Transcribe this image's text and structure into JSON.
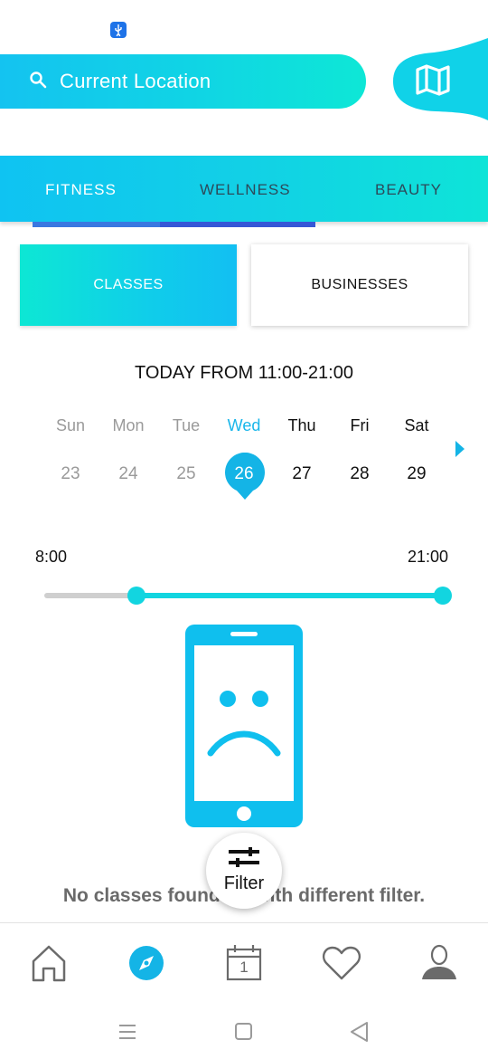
{
  "status_bar": {
    "icons": [
      "usb-icon"
    ]
  },
  "search": {
    "icon": "search-icon",
    "location_label": "Current Location"
  },
  "map_button": {
    "icon": "map-icon"
  },
  "categories": {
    "tabs": [
      {
        "label": "FITNESS",
        "active": true
      },
      {
        "label": "WELLNESS",
        "active": false
      },
      {
        "label": "BEAUTY",
        "active": false
      }
    ]
  },
  "segments": {
    "classes_label": "CLASSES",
    "businesses_label": "BUSINESSES",
    "selected": "CLASSES"
  },
  "schedule": {
    "time_range": "TODAY FROM 11:00-21:00",
    "days": [
      {
        "name": "Sun",
        "date": "23",
        "state": "past"
      },
      {
        "name": "Mon",
        "date": "24",
        "state": "past"
      },
      {
        "name": "Tue",
        "date": "25",
        "state": "past"
      },
      {
        "name": "Wed",
        "date": "26",
        "state": "selected"
      },
      {
        "name": "Thu",
        "date": "27",
        "state": "future"
      },
      {
        "name": "Fri",
        "date": "28",
        "state": "future"
      },
      {
        "name": "Sat",
        "date": "29",
        "state": "future"
      }
    ],
    "next_icon": "chevron-right-icon"
  },
  "time_slider": {
    "min_label": "8:00",
    "max_label": "21:00",
    "range_start": "11:00",
    "range_end": "21:00"
  },
  "empty_state": {
    "icon": "sad-phone-icon",
    "message": "No classes found try with different filter."
  },
  "filter": {
    "label": "Filter",
    "icon": "filter-sliders-icon"
  },
  "bottom_nav": {
    "items": [
      {
        "icon": "home-icon",
        "active": false
      },
      {
        "icon": "compass-icon",
        "active": true
      },
      {
        "icon": "calendar-icon",
        "active": false,
        "badge_text": "1"
      },
      {
        "icon": "heart-icon",
        "active": false
      },
      {
        "icon": "profile-icon",
        "active": false
      }
    ]
  },
  "system_nav": {
    "icons": [
      "recents-icon",
      "home-square-icon",
      "back-triangle-icon"
    ]
  },
  "colors": {
    "accent_cyan": "#12c6ee",
    "accent_teal": "#0ee6d6",
    "tab_indicator": "#3a6bdc",
    "muted_text": "#9a9a9a",
    "message_text": "#6a6a6a"
  }
}
